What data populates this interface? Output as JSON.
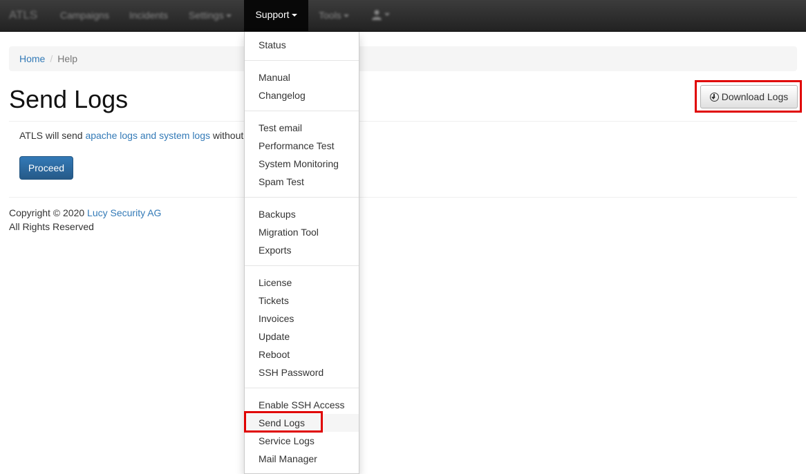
{
  "navbar": {
    "brand": "ATLS",
    "items": [
      {
        "label": "Campaigns"
      },
      {
        "label": "Incidents"
      },
      {
        "label": "Settings"
      },
      {
        "label": "Support"
      },
      {
        "label": "Tools"
      }
    ]
  },
  "dropdown": {
    "groups": [
      [
        "Status"
      ],
      [
        "Manual",
        "Changelog"
      ],
      [
        "Test email",
        "Performance Test",
        "System Monitoring",
        "Spam Test"
      ],
      [
        "Backups",
        "Migration Tool",
        "Exports"
      ],
      [
        "License",
        "Tickets",
        "Invoices",
        "Update",
        "Reboot",
        "SSH Password"
      ],
      [
        "Enable SSH Access",
        "Send Logs",
        "Service Logs",
        "Mail Manager"
      ]
    ],
    "highlighted_item": "Send Logs"
  },
  "breadcrumb": {
    "home": "Home",
    "separator": "/",
    "current": "Help"
  },
  "page": {
    "title": "Send Logs",
    "download_button": "Download Logs",
    "intro_prefix": "ATLS will send ",
    "intro_link": "apache logs and system logs",
    "intro_suffix": " without",
    "proceed_button": "Proceed"
  },
  "footer": {
    "copyright_prefix": "Copyright © 2020 ",
    "company": "Lucy Security AG",
    "rights": "All Rights Reserved"
  },
  "colors": {
    "navbar_bg": "#222222",
    "link": "#337ab7",
    "primary_button": "#337ab7",
    "highlight_box": "#e00000"
  }
}
